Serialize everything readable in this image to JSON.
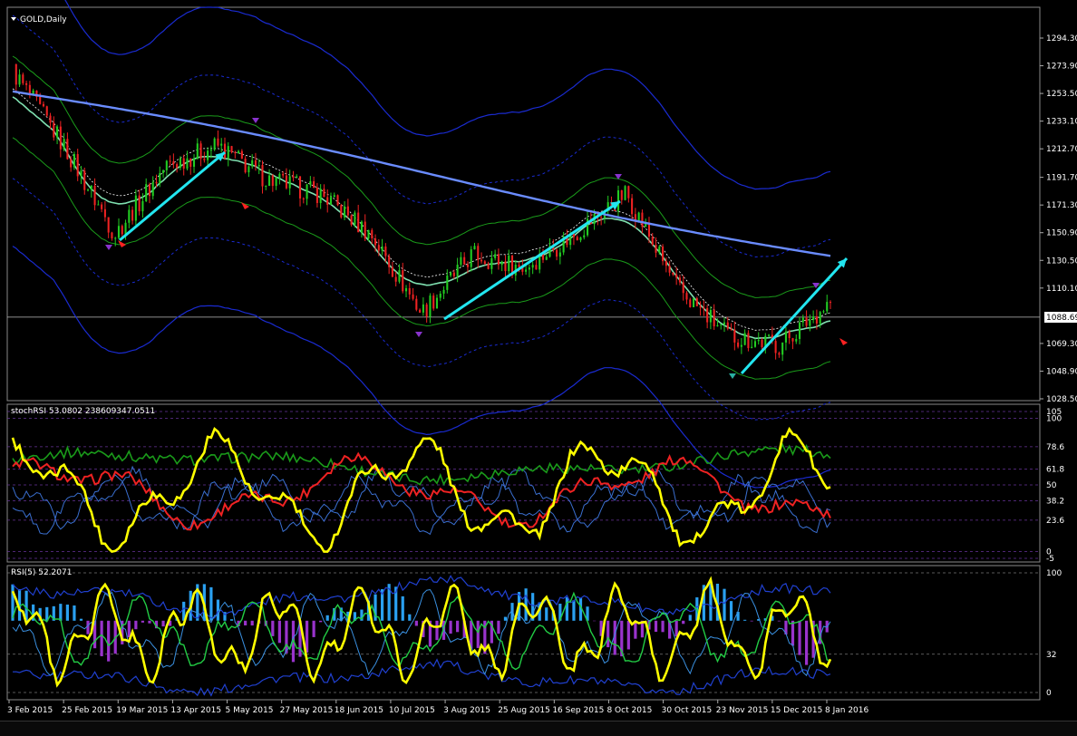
{
  "window": {
    "title": "GOLD,Daily",
    "last_price_label": "1088.69"
  },
  "colors": {
    "background": "#000000",
    "bull_candle": "#22cc22",
    "bear_candle": "#ee2222",
    "ma_long": "#6a8cff",
    "channel_outer": "#1a2bd0",
    "channel_inner": "#1a9b1a",
    "trend_arrow": "#22e6f0",
    "stoch_main": "#ffff00",
    "stoch_signal": "#ee2222",
    "rsi_main": "#ffff00",
    "hist_positive": "#2aa0f0",
    "hist_negative": "#9933cc",
    "grid_text": "#ffffff",
    "fractal_up": "#8833cc",
    "fractal_down": "#ff2222"
  },
  "icons": {
    "menu": "triangle-down-icon",
    "fractal": "arrow-icon",
    "trend": "arrow-icon"
  },
  "price_panel": {
    "levels": [
      "1294.30",
      "1273.90",
      "1253.50",
      "1233.10",
      "1212.70",
      "1191.70",
      "1171.30",
      "1150.90",
      "1130.50",
      "1110.10",
      "1088.69",
      "1069.30",
      "1048.90",
      "1028.50"
    ]
  },
  "stoch_panel": {
    "title": "stochRSI 53.0802 238609347.0511",
    "levels": [
      "105",
      "100",
      "78.6",
      "61.8",
      "50",
      "38.2",
      "23.6",
      "0",
      "-5"
    ]
  },
  "rsi_panel": {
    "title": "RSI(5) 52.2071",
    "levels": [
      "100",
      "32",
      "0"
    ]
  },
  "time_axis": {
    "labels": [
      "3 Feb 2015",
      "25 Feb 2015",
      "19 Mar 2015",
      "13 Apr 2015",
      "5 May 2015",
      "27 May 2015",
      "18 Jun 2015",
      "10 Jul 2015",
      "3 Aug 2015",
      "25 Aug 2015",
      "16 Sep 2015",
      "8 Oct 2015",
      "30 Oct 2015",
      "23 Nov 2015",
      "15 Dec 2015",
      "8 Jan 2016"
    ]
  },
  "chart_data": {
    "type": "candlestick",
    "title": "GOLD,Daily",
    "xlabel": "",
    "ylabel": "",
    "ylim": [
      1020,
      1300
    ],
    "x": [
      "3 Feb 2015",
      "25 Feb 2015",
      "19 Mar 2015",
      "13 Apr 2015",
      "5 May 2015",
      "27 May 2015",
      "18 Jun 2015",
      "10 Jul 2015",
      "3 Aug 2015",
      "25 Aug 2015",
      "16 Sep 2015",
      "8 Oct 2015",
      "30 Oct 2015",
      "23 Nov 2015",
      "15 Dec 2015",
      "8 Jan 2016"
    ],
    "series": [
      {
        "values": [
          1270,
          1215,
          1150,
          1200,
          1215,
          1190,
          1180,
          1150,
          1092,
          1135,
          1125,
          1150,
          1180,
          1110,
          1075,
          1068,
          1100
        ]
      }
    ],
    "stoch_rsi_last": 53.0802,
    "rsi5_last": 52.2071,
    "last_price": 1088.69
  }
}
